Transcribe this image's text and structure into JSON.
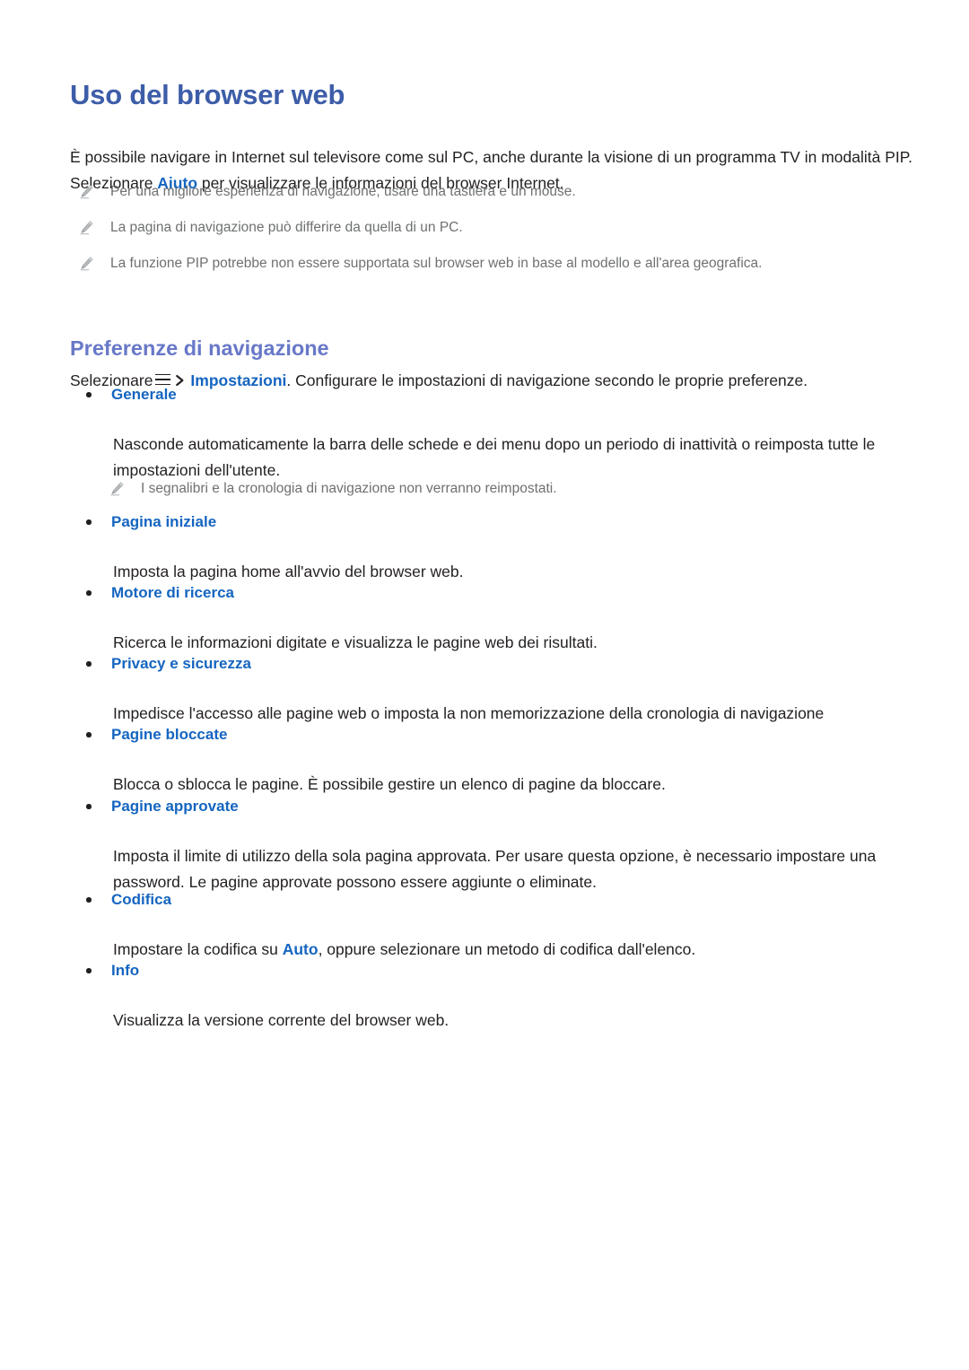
{
  "page": {
    "title": "Uso del browser web",
    "intro": {
      "part1": "È possibile navigare in Internet sul televisore come sul PC, anche durante la visione di un programma TV in modalità PIP. Selezionare ",
      "keyword": "Aiuto",
      "part2": " per visualizzare le informazioni del browser Internet."
    },
    "top_notes": [
      {
        "icon": "pencil-note-icon",
        "text": "Per una migliore esperienza di navigazione, usare una tastiera e un mouse."
      },
      {
        "icon": "pencil-note-icon",
        "text": "La pagina di navigazione può differire da quella di un PC."
      },
      {
        "icon": "pencil-note-icon",
        "text": "La funzione PIP potrebbe non essere supportata sul browser web in base al modello e all'area geografica."
      }
    ],
    "section": {
      "heading": "Preferenze di navigazione",
      "lead": {
        "part1": "Selezionare",
        "menu_icon": "hamburger-menu-icon",
        "chevron_icon": "chevron-right-icon",
        "keyword": "Impostazioni",
        "part2": ". Configurare le impostazioni di navigazione secondo le proprie preferenze."
      },
      "items": [
        {
          "label": "Generale",
          "body": "Nasconde automaticamente la barra delle schede e dei menu dopo un periodo di inattività o reimposta tutte le impostazioni dell'utente.",
          "note": {
            "icon": "pencil-note-icon",
            "text": "I segnalibri e la cronologia di navigazione non verranno reimpostati."
          }
        },
        {
          "label": "Pagina iniziale",
          "body": "Imposta la pagina home all'avvio del browser web."
        },
        {
          "label": "Motore di ricerca",
          "body": "Ricerca le informazioni digitate e visualizza le pagine web dei risultati."
        },
        {
          "label": "Privacy e sicurezza",
          "body": "Impedisce l'accesso alle pagine web o imposta la non memorizzazione della cronologia di navigazione"
        },
        {
          "label": "Pagine bloccate",
          "body": "Blocca o sblocca le pagine. È possibile gestire un elenco di pagine da bloccare."
        },
        {
          "label": "Pagine approvate",
          "body": "Imposta il limite di utilizzo della sola pagina approvata. Per usare questa opzione, è necessario impostare una password. Le pagine approvate possono essere aggiunte o eliminate."
        },
        {
          "label": "Codifica",
          "body_part1": "Impostare la codifica su ",
          "body_keyword": "Auto",
          "body_part2": ", oppure selezionare un metodo di codifica dall'elenco."
        },
        {
          "label": "Info",
          "body": "Visualizza la versione corrente del browser web."
        }
      ]
    }
  },
  "colors": {
    "title_blue": "#3d5da8",
    "section_blue": "#6878c8",
    "keyword_blue": "#1565c0",
    "body_text": "#231f20",
    "note_gray": "#6e7072",
    "page_background": "#ffffff"
  }
}
